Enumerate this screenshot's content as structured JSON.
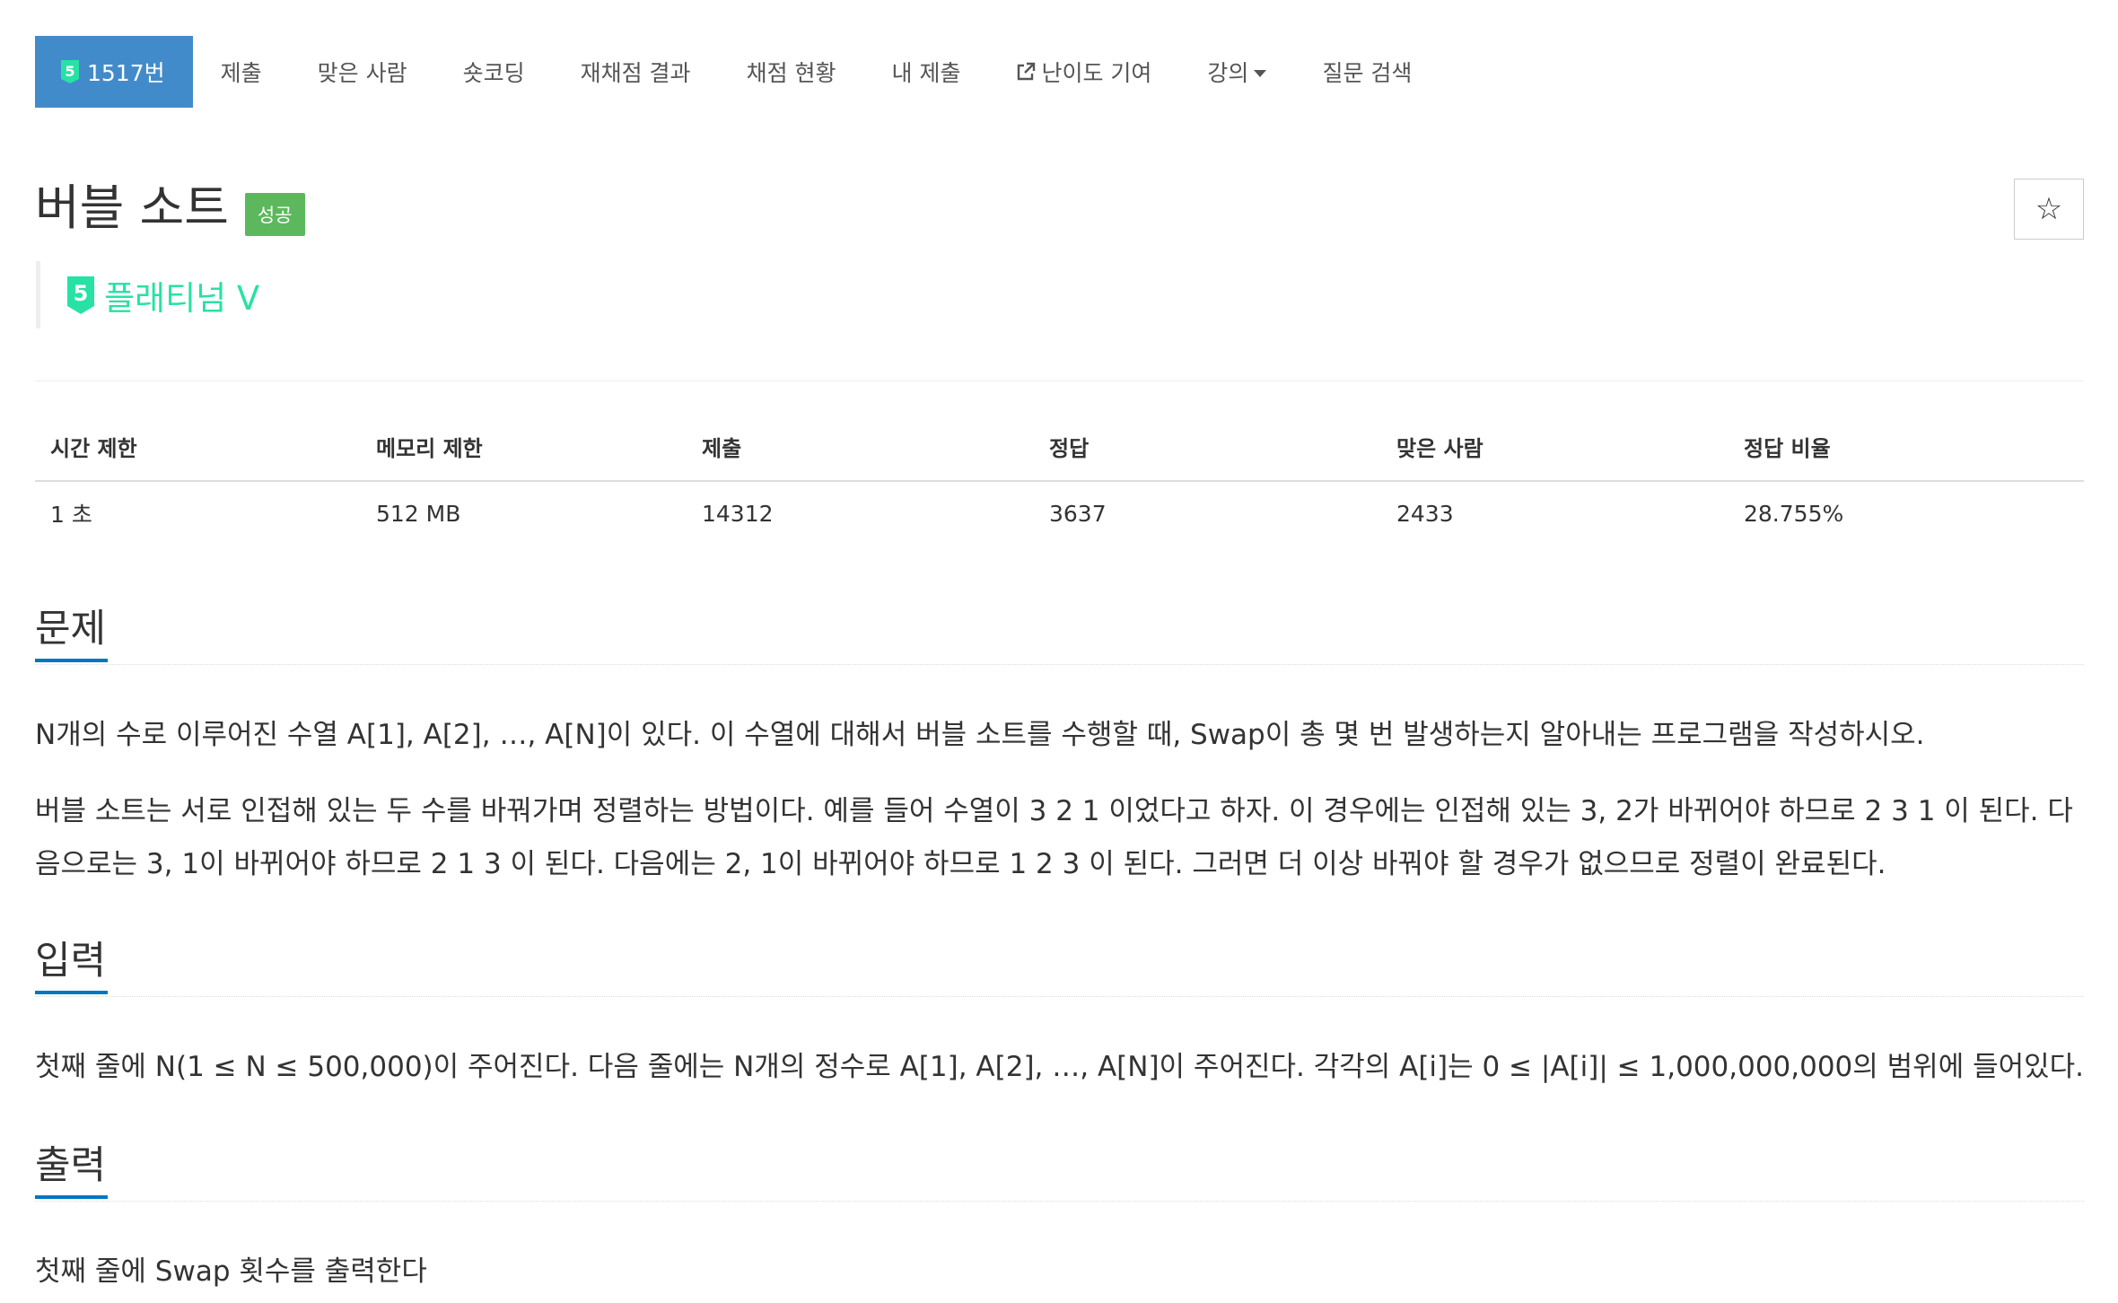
{
  "nav": {
    "problem_tab": "1517번",
    "tier_level": "5",
    "tabs": [
      "제출",
      "맞은 사람",
      "숏코딩",
      "재채점 결과",
      "채점 현황",
      "내 제출"
    ],
    "difficulty_tab": "난이도 기여",
    "lecture_tab": "강의",
    "qa_tab": "질문 검색"
  },
  "header": {
    "title": "버블 소트",
    "status_label": "성공",
    "tier_name": "플래티넘 V",
    "tier_number": "5",
    "star_symbol": "☆"
  },
  "info": {
    "headers": [
      "시간 제한",
      "메모리 제한",
      "제출",
      "정답",
      "맞은 사람",
      "정답 비율"
    ],
    "values": [
      "1 초",
      "512 MB",
      "14312",
      "3637",
      "2433",
      "28.755%"
    ]
  },
  "problem": {
    "heading": "문제",
    "paragraphs": [
      "N개의 수로 이루어진 수열 A[1], A[2], …, A[N]이 있다. 이 수열에 대해서 버블 소트를 수행할 때, Swap이 총 몇 번 발생하는지 알아내는 프로그램을 작성하시오.",
      "버블 소트는 서로 인접해 있는 두 수를 바꿔가며 정렬하는 방법이다. 예를 들어 수열이 3 2 1 이었다고 하자. 이 경우에는 인접해 있는 3, 2가 바뀌어야 하므로 2 3 1 이 된다. 다음으로는 3, 1이 바뀌어야 하므로 2 1 3 이 된다. 다음에는 2, 1이 바뀌어야 하므로 1 2 3 이 된다. 그러면 더 이상 바꿔야 할 경우가 없으므로 정렬이 완료된다."
    ]
  },
  "input": {
    "heading": "입력",
    "text": "첫째 줄에 N(1 ≤ N ≤ 500,000)이 주어진다. 다음 줄에는 N개의 정수로 A[1], A[2], …, A[N]이 주어진다. 각각의 A[i]는 0 ≤ |A[i]| ≤ 1,000,000,000의 범위에 들어있다."
  },
  "output": {
    "heading": "출력",
    "text": "첫째 줄에 Swap 횟수를 출력한다"
  },
  "colors": {
    "active_tab": "#428bca",
    "success": "#5cb85c",
    "platinum": "#27e2a4",
    "section_underline": "#0076c0"
  }
}
